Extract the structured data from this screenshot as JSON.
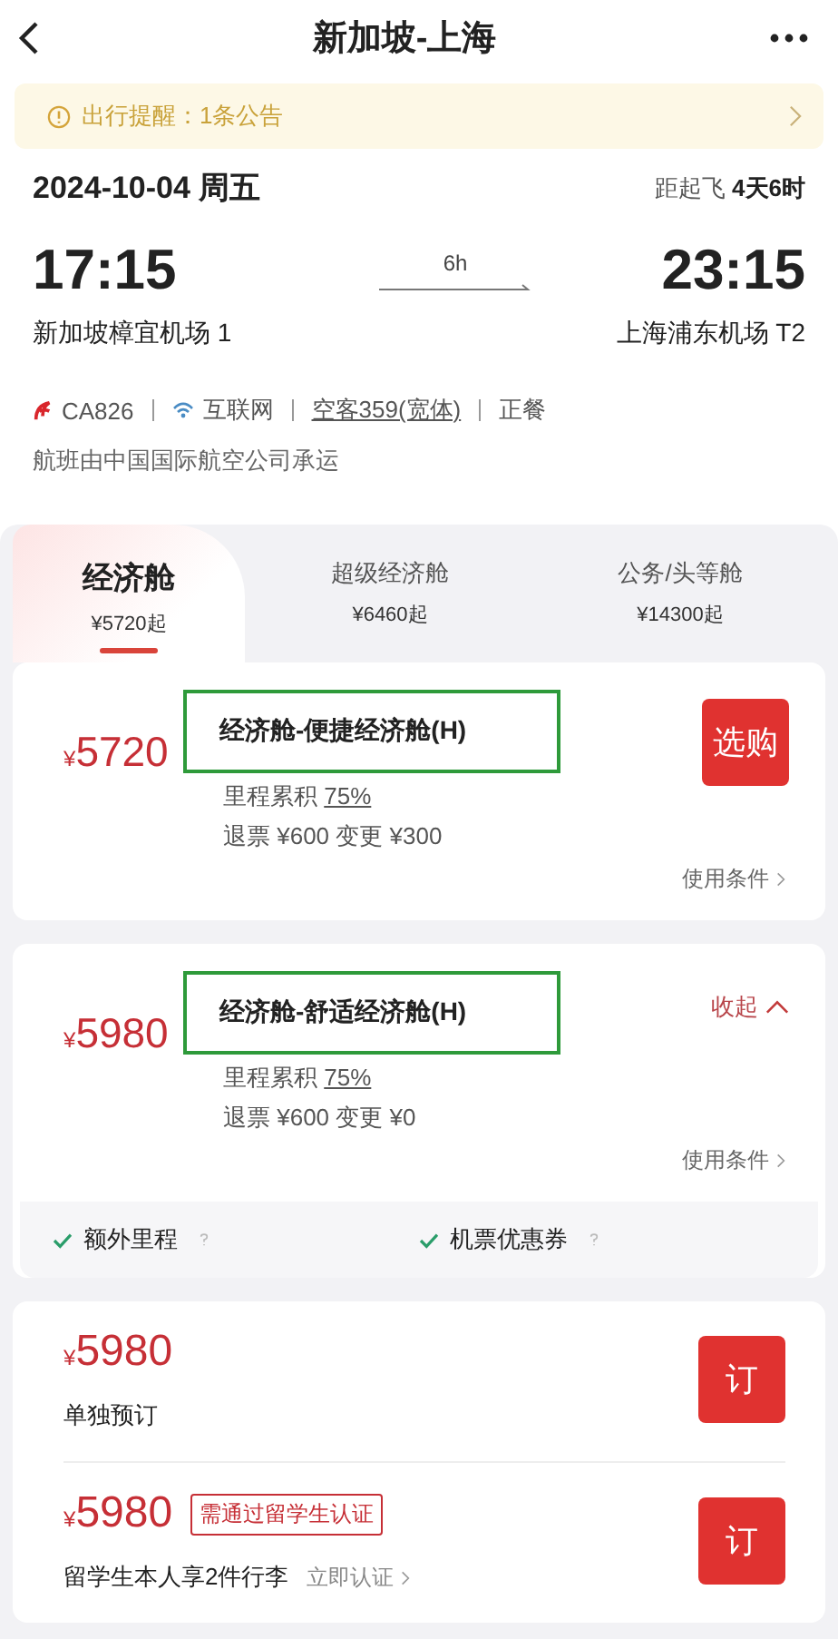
{
  "header": {
    "title": "新加坡-上海"
  },
  "notice": {
    "text": "出行提醒：1条公告"
  },
  "flight": {
    "date": "2024-10-04 周五",
    "countdown_label": "距起飞",
    "countdown": "4天6时",
    "depart_time": "17:15",
    "depart_airport": "新加坡樟宜机场 1",
    "duration": "6h",
    "arrive_time": "23:15",
    "arrive_airport": "上海浦东机场 T2",
    "details": [
      {
        "kind": "airline",
        "text": "CA826"
      },
      {
        "kind": "wifi",
        "text": "互联网"
      },
      {
        "kind": "link",
        "text": "空客359(宽体)"
      },
      {
        "kind": "plain",
        "text": "正餐"
      }
    ],
    "operator": "航班由中国国际航空公司承运"
  },
  "cabin_tabs": [
    {
      "label": "经济舱",
      "price": "¥5720起",
      "selected": true
    },
    {
      "label": "超级经济舱",
      "price": "¥6460起",
      "selected": false
    },
    {
      "label": "公务/头等舱",
      "price": "¥14300起",
      "selected": false
    }
  ],
  "fares": [
    {
      "currency": "¥",
      "price": "5720",
      "title": "经济舱-便捷经济舱(H)",
      "highlighted": true,
      "miles_label": "里程累积",
      "miles": "75%",
      "refund": "退票 ¥600 变更 ¥300",
      "conditions": "使用条件",
      "action": {
        "kind": "button",
        "label": "选购"
      }
    },
    {
      "currency": "¥",
      "price": "5980",
      "title": "经济舱-舒适经济舱(H)",
      "highlighted": true,
      "miles_label": "里程累积",
      "miles": "75%",
      "refund": "退票 ¥600 变更 ¥0",
      "conditions": "使用条件",
      "action": {
        "kind": "toggle",
        "label": "收起",
        "expanded": true
      },
      "features": [
        "额外里程",
        "机票优惠券"
      ]
    }
  ],
  "options": [
    {
      "currency": "¥",
      "price": "5980",
      "description": "单独预订",
      "button": "订"
    },
    {
      "currency": "¥",
      "price": "5980",
      "tag": "需通过留学生认证",
      "description": "留学生本人享2件行李",
      "link": "立即认证",
      "button": "订"
    }
  ]
}
